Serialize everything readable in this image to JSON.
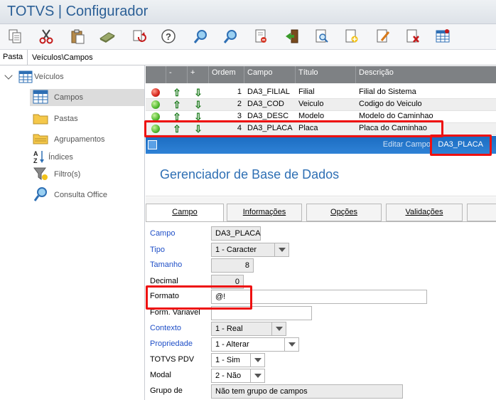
{
  "app": {
    "title": "TOTVS | Configurador"
  },
  "toolbar": {
    "icons": [
      "copy-icon",
      "cut-icon",
      "paste-icon",
      "money-icon",
      "refresh-icon",
      "help-icon",
      "search-icon",
      "find-next-icon",
      "import-icon",
      "exit-icon",
      "preview-icon",
      "new-icon",
      "edit-icon",
      "delete-icon",
      "grid-icon"
    ]
  },
  "path": {
    "label": "Pasta",
    "value": "Veículos\\Campos"
  },
  "sidebar": {
    "root": "Veículos",
    "items": [
      {
        "label": "Campos",
        "icon": "table-icon",
        "selected": true
      },
      {
        "label": "Pastas",
        "icon": "folder-icon"
      },
      {
        "label": "Agrupamentos",
        "icon": "folders-icon"
      },
      {
        "label": "Índices",
        "icon": "sort-az-icon"
      },
      {
        "label": "Filtro(s)",
        "icon": "filter-icon"
      },
      {
        "label": "Consulta Office",
        "icon": "search-icon"
      }
    ]
  },
  "grid": {
    "columns": [
      "",
      "-",
      "+",
      "Ordem",
      "Campo",
      "Título",
      "Descrição"
    ],
    "rows": [
      {
        "status": "red",
        "ordem": "1",
        "campo": "DA3_FILIAL",
        "titulo": "Filial",
        "descricao": "Filial do Sistema"
      },
      {
        "status": "green",
        "ordem": "2",
        "campo": "DA3_COD",
        "titulo": "Veiculo",
        "descricao": "Codigo do Veiculo"
      },
      {
        "status": "green",
        "ordem": "3",
        "campo": "DA3_DESC",
        "titulo": "Modelo",
        "descricao": "Modelo do Caminhao"
      },
      {
        "status": "green",
        "ordem": "4",
        "campo": "DA3_PLACA",
        "titulo": "Placa",
        "descricao": "Placa do Caminhao"
      }
    ]
  },
  "editbar": {
    "label": "Editar Campo",
    "value": "DA3_PLACA"
  },
  "manager": {
    "title": "Gerenciador de Base de Dados"
  },
  "tabs": [
    {
      "label": "Campo",
      "active": true
    },
    {
      "label": "Informações"
    },
    {
      "label": "Opções"
    },
    {
      "label": "Validações"
    }
  ],
  "form": {
    "campo": {
      "label": "Campo",
      "value": "DA3_PLACA"
    },
    "tipo": {
      "label": "Tipo",
      "value": "1 - Caracter"
    },
    "tamanho": {
      "label": "Tamanho",
      "value": "8"
    },
    "decimal": {
      "label": "Decimal",
      "value": "0"
    },
    "formato": {
      "label": "Formato",
      "value": "@!"
    },
    "form_variavel": {
      "label": "Form. Variavel",
      "value": ""
    },
    "contexto": {
      "label": "Contexto",
      "value": "1 - Real"
    },
    "propriedade": {
      "label": "Propriedade",
      "value": "1 - Alterar"
    },
    "totvs_pdv": {
      "label": "TOTVS PDV",
      "value": "1 - Sim"
    },
    "modal": {
      "label": "Modal",
      "value": "2 - Não"
    },
    "grupo": {
      "label": "Grupo de",
      "value": "Não tem grupo de campos"
    }
  },
  "colors": {
    "accent": "#2e6fb4",
    "titlebar_text": "#2b5f96",
    "highlight": "#ee1111",
    "header_bg": "#7e8184"
  }
}
